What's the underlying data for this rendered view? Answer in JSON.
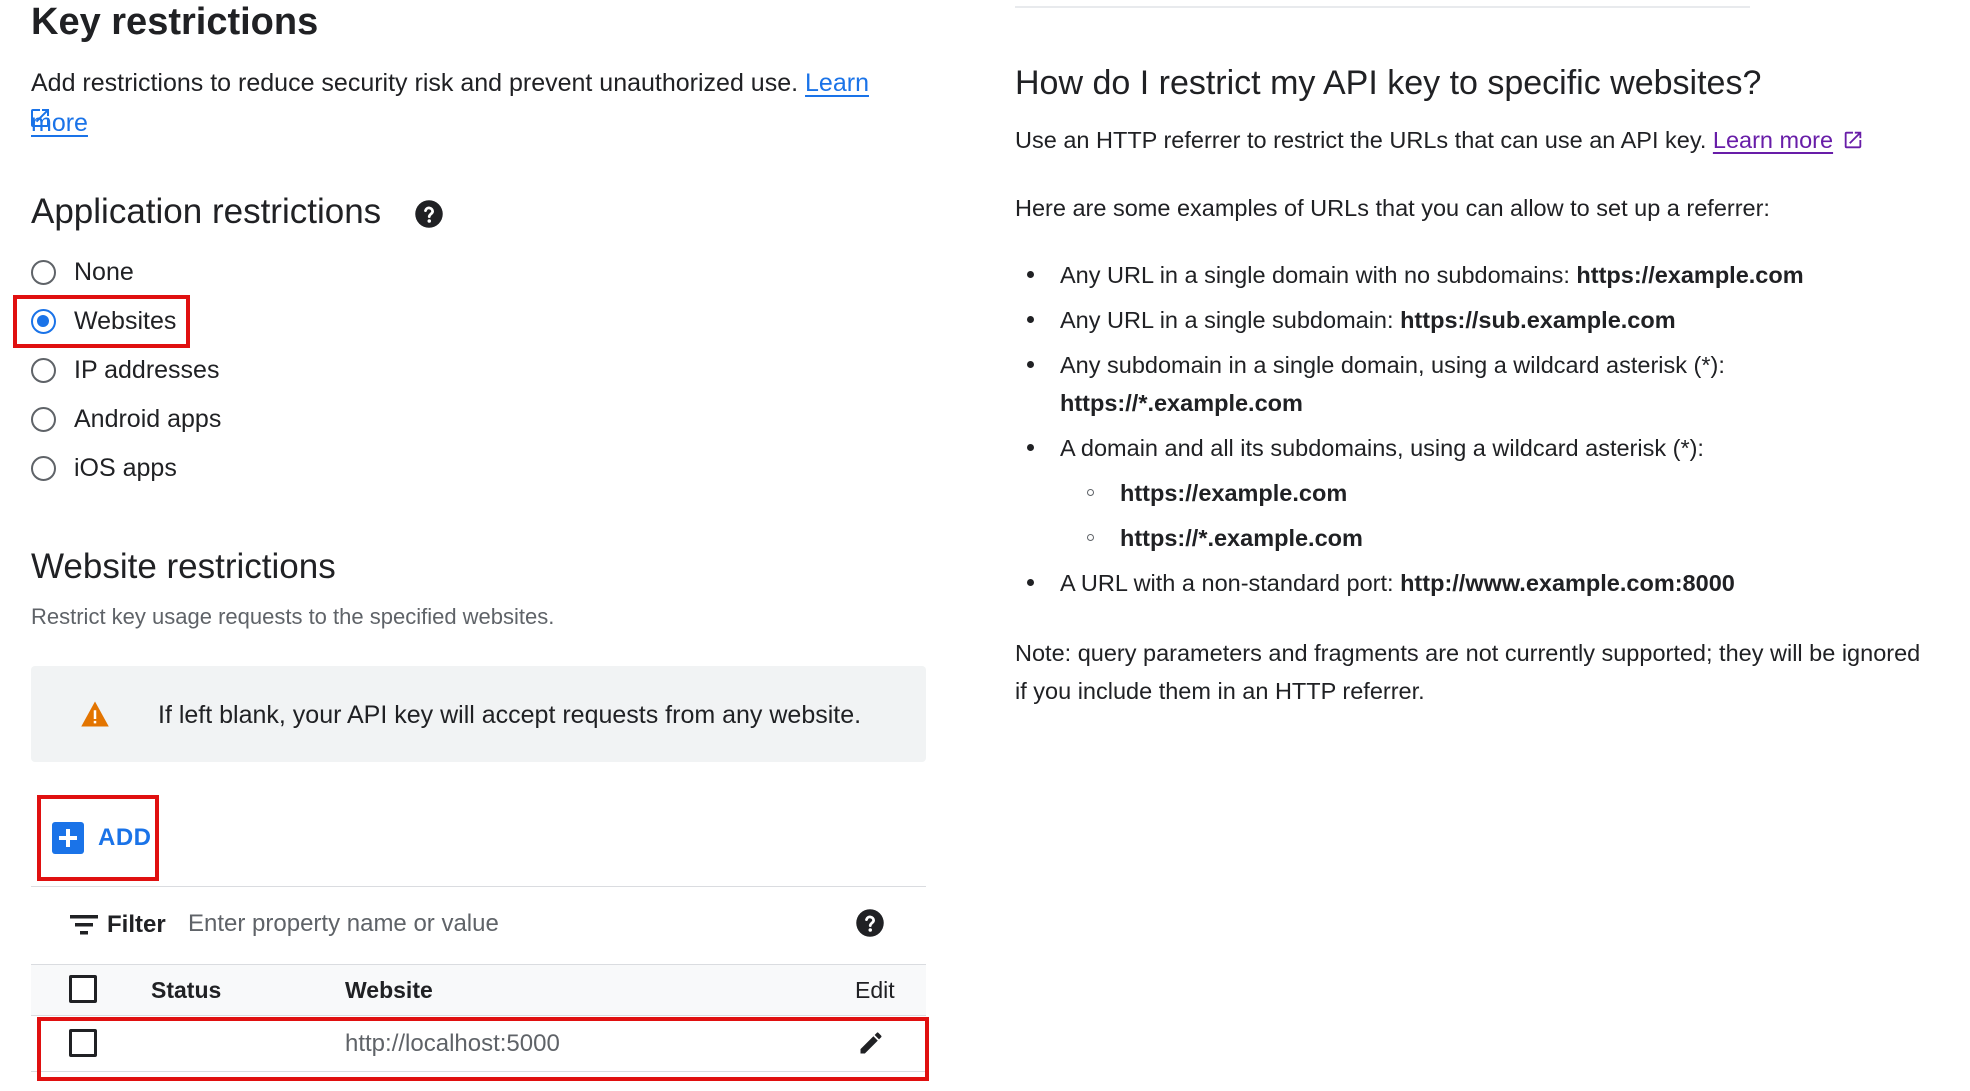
{
  "left": {
    "title": "Key restrictions",
    "description": "Add restrictions to reduce security risk and prevent unauthorized use.",
    "learn_more": "Learn more",
    "app_restrictions": {
      "title": "Application restrictions",
      "options": [
        {
          "label": "None",
          "selected": false
        },
        {
          "label": "Websites",
          "selected": true
        },
        {
          "label": "IP addresses",
          "selected": false
        },
        {
          "label": "Android apps",
          "selected": false
        },
        {
          "label": "iOS apps",
          "selected": false
        }
      ]
    },
    "website_restrictions": {
      "title": "Website restrictions",
      "subtitle": "Restrict key usage requests to the specified websites.",
      "warning": "If left blank, your API key will accept requests from any website.",
      "add_label": "ADD",
      "filter_label": "Filter",
      "filter_placeholder": "Enter property name or value",
      "columns": {
        "status": "Status",
        "website": "Website",
        "edit": "Edit"
      },
      "rows": [
        {
          "website": "http://localhost:5000"
        }
      ]
    }
  },
  "right": {
    "title": "How do I restrict my API key to specific websites?",
    "intro": "Use an HTTP referrer to restrict the URLs that can use an API key.",
    "learn_more": "Learn more",
    "examples_intro": "Here are some examples of URLs that you can allow to set up a referrer:",
    "b1_text": "Any URL in a single domain with no subdomains:",
    "b1_url": "https://example.com",
    "b2_text": "Any URL in a single subdomain:",
    "b2_url": "https://sub.example.com",
    "b3_text": "Any subdomain in a single domain, using a wildcard asterisk (*):",
    "b3_url": "https://*.example.com",
    "b4_text": "A domain and all its subdomains, using a wildcard asterisk (*):",
    "b4_sub1": "https://example.com",
    "b4_sub2": "https://*.example.com",
    "b5_text": "A URL with a non-standard port:",
    "b5_url": "http://www.example.com:8000",
    "note_line1": "Note: query parameters and fragments are not currently supported; they will be ignored",
    "note_line2": "if you include them in an HTTP referrer."
  },
  "colors": {
    "accent": "#1a73e8",
    "highlight": "#e01010",
    "warning": "#e37400",
    "visited_link": "#681da8"
  }
}
